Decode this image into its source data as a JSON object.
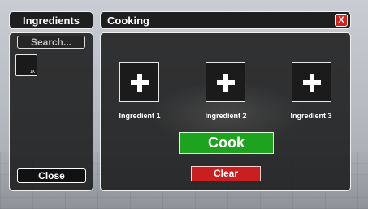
{
  "ingredients_panel": {
    "title": "Ingredients",
    "search_placeholder": "Search...",
    "items": [
      {
        "count": "1X"
      }
    ],
    "close_label": "Close"
  },
  "cooking_panel": {
    "title": "Cooking",
    "close_x": "X",
    "slots": [
      {
        "label": "Ingredient 1",
        "icon": "plus-icon"
      },
      {
        "label": "Ingredient 2",
        "icon": "plus-icon"
      },
      {
        "label": "Ingredient 3",
        "icon": "plus-icon"
      }
    ],
    "cook_label": "Cook",
    "clear_label": "Clear"
  },
  "colors": {
    "cook_green": "#1ea31e",
    "clear_red": "#c91f1f",
    "close_red": "#d81e1e"
  }
}
